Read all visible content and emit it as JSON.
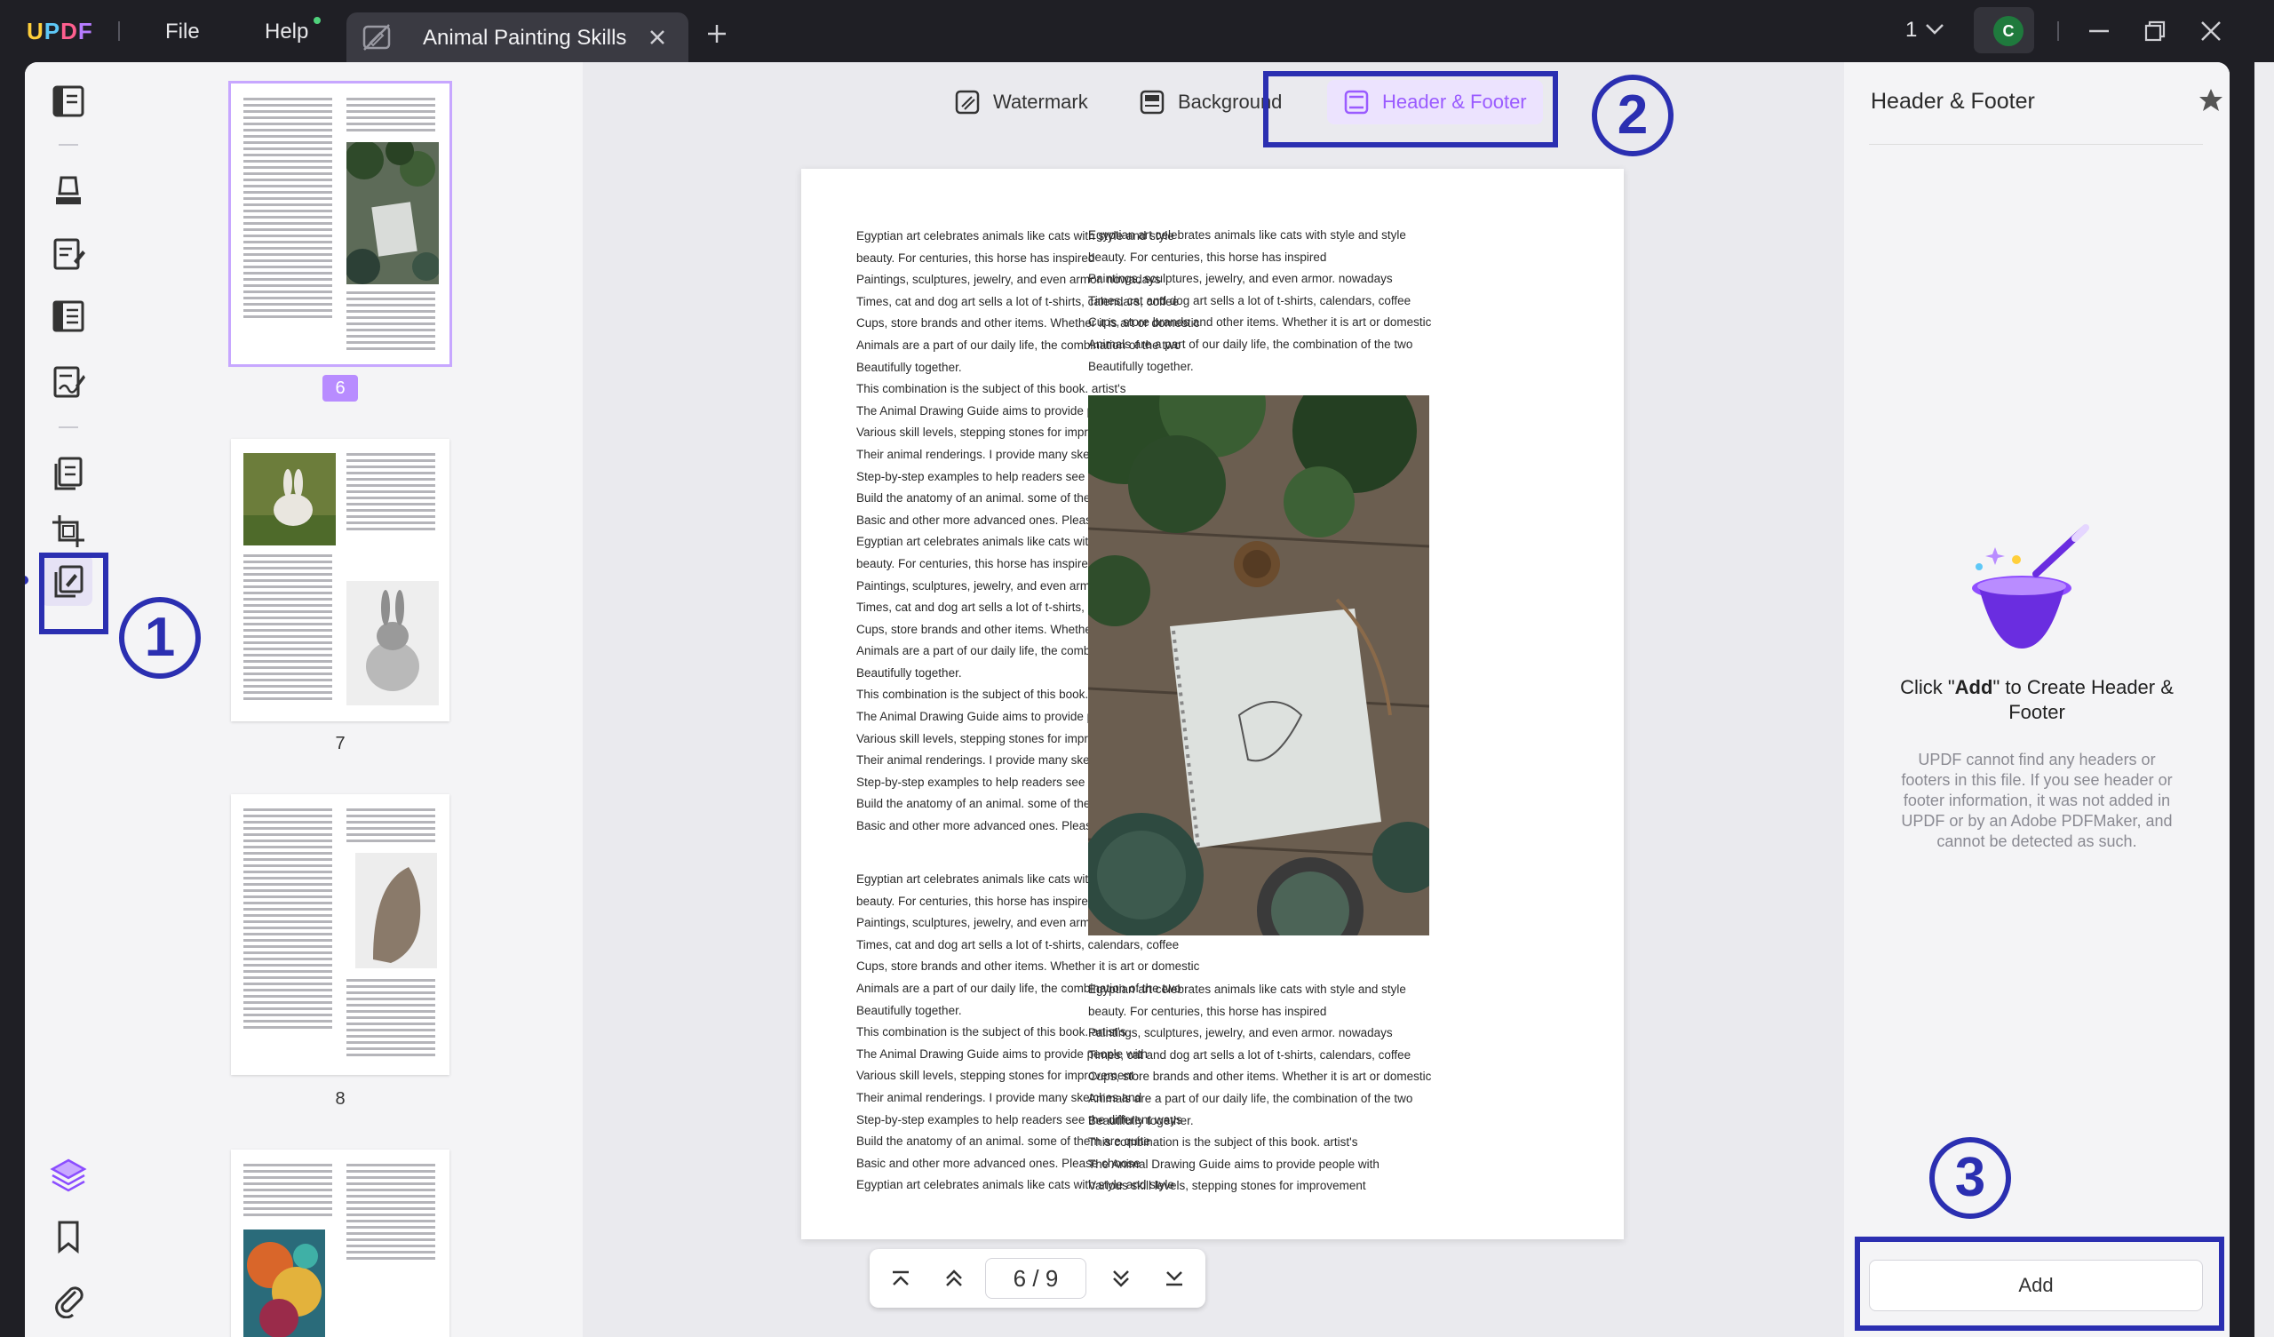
{
  "titlebar": {
    "menu_file": "File",
    "menu_help": "Help",
    "tab_title": "Animal Painting Skills",
    "page_indicator": "1",
    "avatar_letter": "C"
  },
  "toolbar": {
    "watermark": "Watermark",
    "background": "Background",
    "header_footer": "Header & Footer"
  },
  "thumbnails": [
    {
      "page": "6",
      "selected": true
    },
    {
      "page": "7",
      "selected": false
    },
    {
      "page": "8",
      "selected": false
    }
  ],
  "document": {
    "left_col": [
      "Egyptian art celebrates animals like cats with style and style",
      "beauty. For centuries, this horse has inspired",
      "Paintings, sculptures, jewelry, and even armor. nowadays",
      "Times, cat and dog art sells a lot of t-shirts, calendars, coffee",
      "Cups, store brands and other items. Whether it is art or domestic",
      "Animals are a part of our daily life, the combination of the two",
      "Beautifully together.",
      "This combination is the subject of this book. artist's",
      "The Animal Drawing Guide aims to provide people with",
      "Various skill levels, stepping stones for improvement",
      "Their animal renderings. I provide many sketches and",
      "Step-by-step examples to help readers see the different ways",
      "Build the anatomy of an animal. some of them are quite",
      "Basic and other more advanced ones. Please choose",
      "Egyptian art celebrates animals like cats with style and style",
      "beauty. For centuries, this horse has inspired",
      "Paintings, sculptures, jewelry, and even armor. nowadays",
      "Times, cat and dog art sells a lot of t-shirts, calendars, coffee",
      "Cups, store brands and other items. Whether it is art or domestic",
      "Animals are a part of our daily life, the combination of the two",
      "Beautifully together.",
      "This combination is the subject of this book. artist's",
      "The Animal Drawing Guide aims to provide people with",
      "Various skill levels, stepping stones for improvement",
      "Their animal renderings. I provide many sketches and",
      "Step-by-step examples to help readers see the different ways",
      "Build the anatomy of an animal. some of them are quite",
      "Basic and other more advanced ones. Please choose"
    ],
    "left_col_2": [
      "Egyptian art celebrates animals like cats with style and style",
      "beauty. For centuries, this horse has inspired",
      "Paintings, sculptures, jewelry, and even armor. nowadays",
      "Times, cat and dog art sells a lot of t-shirts, calendars, coffee",
      "Cups, store brands and other items. Whether it is art or domestic",
      "Animals are a part of our daily life, the combination of the two",
      "Beautifully together.",
      "This combination is the subject of this book. artist's",
      "The Animal Drawing Guide aims to provide people with",
      "Various skill levels, stepping stones for improvement",
      "Their animal renderings. I provide many sketches and",
      "Step-by-step examples to help readers see the different ways",
      "Build the anatomy of an animal. some of them are quite",
      "Basic and other more advanced ones. Please choose",
      "Egyptian art celebrates animals like cats with style and style"
    ],
    "right_col_top": [
      "Egyptian art celebrates animals like cats with style and style",
      "beauty. For centuries, this horse has inspired",
      "Paintings, sculptures, jewelry, and even armor. nowadays",
      "Times, cat and dog art sells a lot of t-shirts, calendars, coffee",
      "Cups, store brands and other items. Whether it is art or domestic",
      "Animals are a part of our daily life, the combination of the two",
      "Beautifully together."
    ],
    "right_col_bottom": [
      "Egyptian art celebrates animals like cats with style and style",
      "beauty. For centuries, this horse has inspired",
      "Paintings, sculptures, jewelry, and even armor. nowadays",
      "Times, cat and dog art sells a lot of t-shirts, calendars, coffee",
      "Cups, store brands and other items. Whether it is art or domestic",
      "Animals are a part of our daily life, the combination of the two",
      "Beautifully together.",
      "This combination is the subject of this book. artist's",
      "The Animal Drawing Guide aims to provide people with",
      "Various skill levels, stepping stones for improvement"
    ]
  },
  "pager": {
    "current": "6",
    "separator": "/",
    "total": "9"
  },
  "panel": {
    "title": "Header & Footer",
    "headline_pre": "Click \"",
    "headline_bold": "Add",
    "headline_post": "\" to Create Header & Footer",
    "description": "UPDF cannot find any headers or footers in this file. If you see header or footer information, it was not added in UPDF or by an Adobe PDFMaker, and cannot be detected as such.",
    "add_button": "Add"
  },
  "annotations": [
    "1",
    "2",
    "3"
  ],
  "colors": {
    "accent": "#9a5bff",
    "annotation": "#2b2fb1",
    "titlebar": "#1f1f25"
  }
}
